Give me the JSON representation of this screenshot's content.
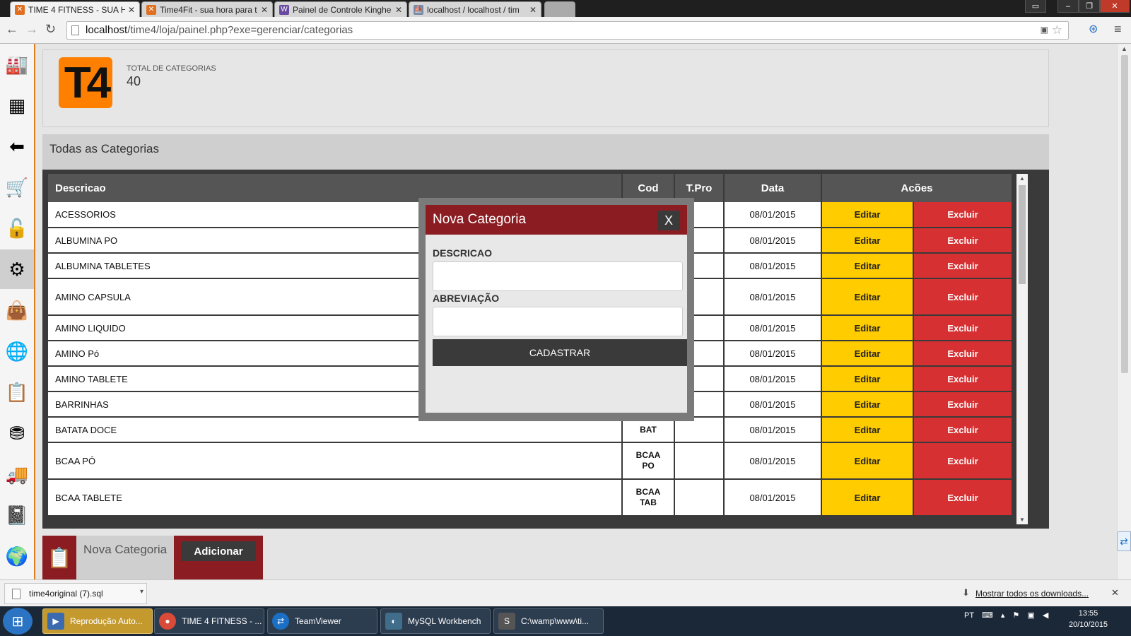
{
  "browser": {
    "tabs": [
      {
        "label": "TIME 4 FITNESS - SUA HO",
        "icon": "time4-favicon",
        "active": true
      },
      {
        "label": "Time4Fit - sua hora para t",
        "icon": "time4-favicon",
        "active": false
      },
      {
        "label": "Painel de Controle Kinghe",
        "icon": "panel-favicon",
        "active": false
      },
      {
        "label": "localhost / localhost / tim",
        "icon": "phpmyadmin-favicon",
        "active": false
      }
    ],
    "url_host": "localhost",
    "url_path": "/time4/loja/painel.php?exe=gerenciar/categorias"
  },
  "sidebar": {
    "items": [
      {
        "icon": "factory-icon",
        "glyph": "🏭"
      },
      {
        "icon": "grid-icon",
        "glyph": "▦"
      },
      {
        "icon": "back-arrow-icon",
        "glyph": "⬅"
      },
      {
        "icon": "cart-icon",
        "glyph": "🛒"
      },
      {
        "icon": "unlock-icon",
        "glyph": "🔓"
      },
      {
        "icon": "gear-icon",
        "glyph": "⚙"
      },
      {
        "icon": "shopping-bag-icon",
        "glyph": "👜"
      },
      {
        "icon": "globe-icon",
        "glyph": "🌐"
      },
      {
        "icon": "clipboard-icon",
        "glyph": "📋"
      },
      {
        "icon": "coins-icon",
        "glyph": "⛃"
      },
      {
        "icon": "truck-icon",
        "glyph": "🚚"
      },
      {
        "icon": "notebook-icon",
        "glyph": "📓"
      },
      {
        "icon": "earth-icon",
        "glyph": "🌍"
      }
    ]
  },
  "summary": {
    "logo_text": "T4",
    "total_label": "TOTAL DE CATEGORIAS",
    "total_value": "40"
  },
  "panel": {
    "title": "Todas as Categorias",
    "columns": {
      "desc": "Descricao",
      "cod": "Cod",
      "tpro": "T.Pro",
      "data": "Data",
      "acoes": "Acões"
    },
    "edit_label": "Editar",
    "delete_label": "Excluir",
    "rows": [
      {
        "desc": "ACESSORIOS",
        "cod": "",
        "tpro": "",
        "data": "08/01/2015"
      },
      {
        "desc": "ALBUMINA PO",
        "cod": "",
        "tpro": "",
        "data": "08/01/2015"
      },
      {
        "desc": "ALBUMINA TABLETES",
        "cod": "",
        "tpro": "",
        "data": "08/01/2015"
      },
      {
        "desc": "AMINO CAPSULA",
        "cod": "",
        "tpro": "",
        "data": "08/01/2015"
      },
      {
        "desc": "AMINO LIQUIDO",
        "cod": "",
        "tpro": "",
        "data": "08/01/2015"
      },
      {
        "desc": "AMINO Pó",
        "cod": "",
        "tpro": "",
        "data": "08/01/2015"
      },
      {
        "desc": "AMINO TABLETE",
        "cod": "",
        "tpro": "",
        "data": "08/01/2015"
      },
      {
        "desc": "BARRINHAS",
        "cod": "",
        "tpro": "",
        "data": "08/01/2015"
      },
      {
        "desc": "BATATA DOCE",
        "cod": "BAT",
        "tpro": "",
        "data": "08/01/2015"
      },
      {
        "desc": "BCAA PÓ",
        "cod": "BCAA PO",
        "tpro": "",
        "data": "08/01/2015"
      },
      {
        "desc": "BCAA TABLETE",
        "cod": "BCAA TAB",
        "tpro": "",
        "data": "08/01/2015"
      }
    ]
  },
  "bottom": {
    "label": "Nova Categoria",
    "add_button": "Adicionar"
  },
  "modal": {
    "title": "Nova Categoria",
    "close_label": "X",
    "field1_label": "DESCRICAO",
    "field1_value": "",
    "field2_label": "ABREVIAÇÃO",
    "field2_value": "",
    "submit_label": "CADASTRAR"
  },
  "downloads": {
    "file": "time4original (7).sql",
    "show_all": "Mostrar todos os downloads..."
  },
  "taskbar": {
    "tasks": [
      {
        "label": "Reprodução Auto...",
        "icon": "autoplay-icon"
      },
      {
        "label": "TIME 4 FITNESS - ...",
        "icon": "chrome-icon"
      },
      {
        "label": "TeamViewer",
        "icon": "teamviewer-icon"
      },
      {
        "label": "MySQL Workbench",
        "icon": "mysql-workbench-icon"
      },
      {
        "label": "C:\\wamp\\www\\ti...",
        "icon": "sublime-text-icon"
      }
    ],
    "lang": "PT",
    "time": "13:55",
    "date": "20/10/2015"
  },
  "colors": {
    "brand_orange": "#ff8000",
    "brand_red": "#8b1d22",
    "edit_yellow": "#ffcc00",
    "delete_red": "#d73032"
  }
}
